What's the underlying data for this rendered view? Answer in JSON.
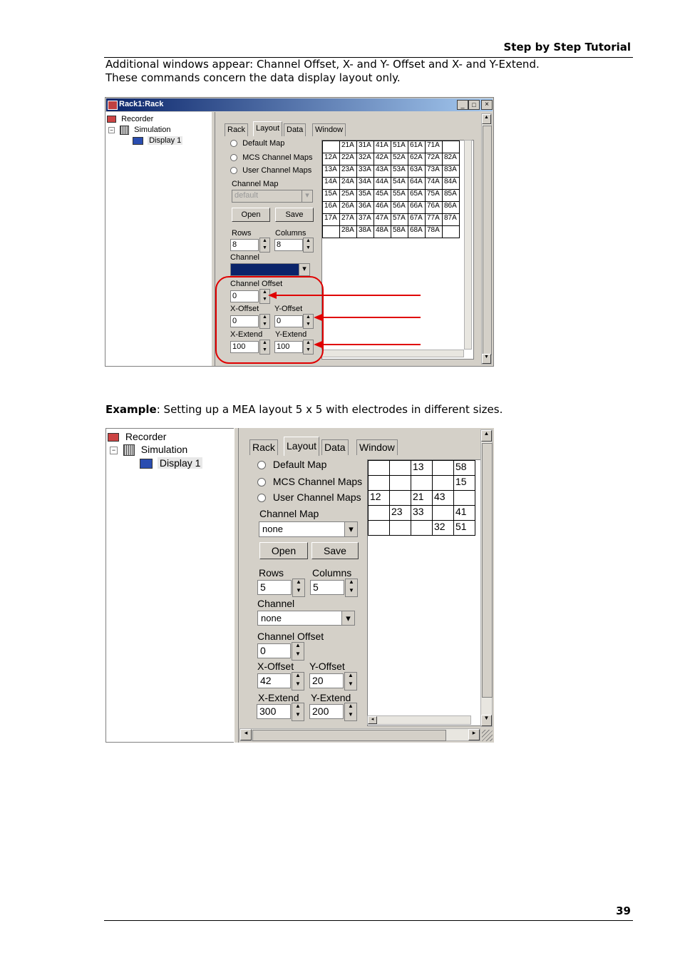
{
  "header": {
    "title": "Step by Step Tutorial"
  },
  "intro": {
    "line1": "Additional windows appear: Channel Offset, X- and Y- Offset and X- and Y-Extend.",
    "line2": "These commands concern the data display layout only."
  },
  "example": {
    "bold": "Example",
    "rest": ": Setting up a MEA layout 5 x 5 with electrodes in different sizes."
  },
  "page_number": "39",
  "window1": {
    "title": "Rack1:Rack",
    "tree": [
      "Recorder",
      "Simulation",
      "Display 1"
    ],
    "tabs": [
      "Rack",
      "Layout",
      "Data",
      "Window"
    ],
    "radios": [
      "Default Map",
      "MCS Channel Maps",
      "User Channel Maps"
    ],
    "channel_map_label": "Channel Map",
    "channel_map_value": "default",
    "open": "Open",
    "save": "Save",
    "rows_label": "Rows",
    "rows": "8",
    "columns_label": "Columns",
    "columns": "8",
    "channel_label": "Channel",
    "channel_offset_label": "Channel Offset",
    "channel_offset": "0",
    "x_offset_label": "X-Offset",
    "x_offset": "0",
    "y_offset_label": "Y-Offset",
    "y_offset": "0",
    "x_extend_label": "X-Extend",
    "x_extend": "100",
    "y_extend_label": "Y-Extend",
    "y_extend": "100",
    "grid": [
      [
        "",
        "21A",
        "31A",
        "41A",
        "51A",
        "61A",
        "71A",
        ""
      ],
      [
        "12A",
        "22A",
        "32A",
        "42A",
        "52A",
        "62A",
        "72A",
        "82A"
      ],
      [
        "13A",
        "23A",
        "33A",
        "43A",
        "53A",
        "63A",
        "73A",
        "83A"
      ],
      [
        "14A",
        "24A",
        "34A",
        "44A",
        "54A",
        "64A",
        "74A",
        "84A"
      ],
      [
        "15A",
        "25A",
        "35A",
        "45A",
        "55A",
        "65A",
        "75A",
        "85A"
      ],
      [
        "16A",
        "26A",
        "36A",
        "46A",
        "56A",
        "66A",
        "76A",
        "86A"
      ],
      [
        "17A",
        "27A",
        "37A",
        "47A",
        "57A",
        "67A",
        "77A",
        "87A"
      ],
      [
        "",
        "28A",
        "38A",
        "48A",
        "58A",
        "68A",
        "78A",
        ""
      ]
    ],
    "highlight_color": "#e00000"
  },
  "window2": {
    "tree": [
      "Recorder",
      "Simulation",
      "Display 1"
    ],
    "tabs": [
      "Rack",
      "Layout",
      "Data",
      "Window"
    ],
    "radios": [
      "Default Map",
      "MCS Channel Maps",
      "User Channel Maps"
    ],
    "channel_map_label": "Channel Map",
    "channel_map_value": "none",
    "open": "Open",
    "save": "Save",
    "rows_label": "Rows",
    "rows": "5",
    "columns_label": "Columns",
    "columns": "5",
    "channel_label": "Channel",
    "channel_value": "none",
    "channel_offset_label": "Channel Offset",
    "channel_offset": "0",
    "x_offset_label": "X-Offset",
    "x_offset": "42",
    "y_offset_label": "Y-Offset",
    "y_offset": "20",
    "x_extend_label": "X-Extend",
    "x_extend": "300",
    "y_extend_label": "Y-Extend",
    "y_extend": "200",
    "grid": [
      [
        "",
        "",
        "13",
        "",
        "58"
      ],
      [
        "",
        "",
        "",
        "",
        "15"
      ],
      [
        "12",
        "",
        "21",
        "43",
        ""
      ],
      [
        "",
        "23",
        "33",
        "",
        "41"
      ],
      [
        "",
        "",
        "",
        "32",
        "51"
      ]
    ]
  }
}
